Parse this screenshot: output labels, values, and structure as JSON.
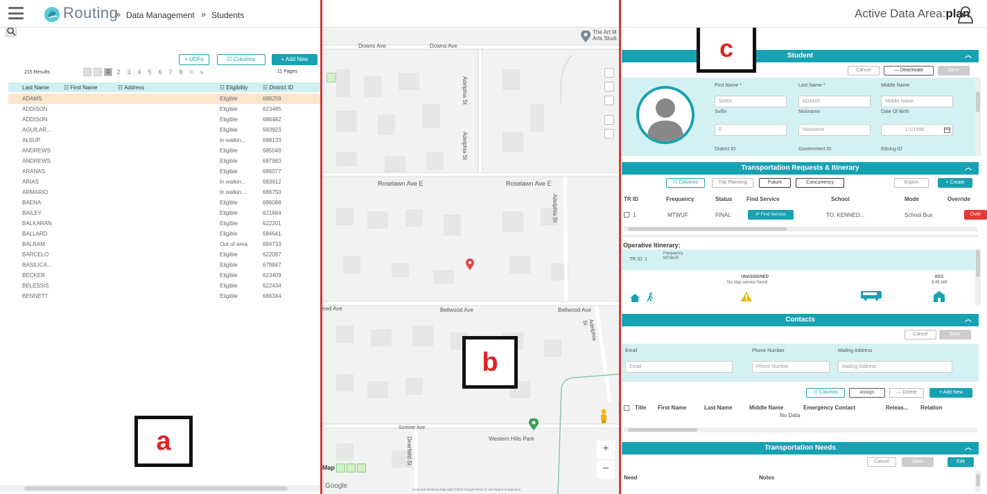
{
  "header": {
    "app_name": "Routing",
    "breadcrumb": [
      "Data Management",
      "Students"
    ],
    "breadcrumb_sep": "»",
    "active_area_label": "Active Data Area:",
    "active_area_value": "plan"
  },
  "panel_a": {
    "label": "a",
    "buttons": {
      "udfs": "+ UDFs",
      "columns": "☷ Columns",
      "add_new": "+ Add New"
    },
    "results": "215 Results",
    "pages": "11 Pages",
    "page_numbers": [
      "1",
      "2",
      "3",
      "4",
      "5",
      "6",
      "7",
      "8"
    ],
    "pager_next": ">",
    "pager_last": "»",
    "columns": [
      "Last Name",
      "☷ First Name",
      "☷ Address",
      "☷ Eligibility",
      "☷ District ID"
    ],
    "rows": [
      {
        "last": "ADAMS",
        "elig": "Eligible",
        "id": "688259"
      },
      {
        "last": "ADDISON",
        "elig": "Eligible",
        "id": "623485"
      },
      {
        "last": "ADDISON",
        "elig": "Eligible",
        "id": "686482"
      },
      {
        "last": "AGUILAR...",
        "elig": "Eligible",
        "id": "683923"
      },
      {
        "last": "ALSUP",
        "elig": "In walkin...",
        "id": "688133"
      },
      {
        "last": "ANDREWS",
        "elig": "Eligible",
        "id": "685049"
      },
      {
        "last": "ANDREWS",
        "elig": "Eligible",
        "id": "687983"
      },
      {
        "last": "ARANAS",
        "elig": "Eligible",
        "id": "686077"
      },
      {
        "last": "ARIAS",
        "elig": "In walkin...",
        "id": "683912"
      },
      {
        "last": "ARMARIO",
        "elig": "In walkin...",
        "id": "686750"
      },
      {
        "last": "BAENA",
        "elig": "Eligible",
        "id": "686088"
      },
      {
        "last": "BAILEY",
        "elig": "Eligible",
        "id": "621684"
      },
      {
        "last": "BALKARAN",
        "elig": "Eligible",
        "id": "622201"
      },
      {
        "last": "BALLARD",
        "elig": "Eligible",
        "id": "684641"
      },
      {
        "last": "BALRAM",
        "elig": "Out of area",
        "id": "684733"
      },
      {
        "last": "BARCELO",
        "elig": "Eligible",
        "id": "622097"
      },
      {
        "last": "BASILICA...",
        "elig": "Eligible",
        "id": "679847"
      },
      {
        "last": "BECKER",
        "elig": "Eligible",
        "id": "623409"
      },
      {
        "last": "BELESSIS",
        "elig": "Eligible",
        "id": "622434"
      },
      {
        "last": "BENNETT",
        "elig": "Eligible",
        "id": "686344"
      }
    ]
  },
  "panel_b": {
    "label": "b",
    "streets": {
      "downs1": "Downs Ave",
      "downs2": "Downs Ave",
      "adelphia1": "Adelphia St",
      "adelphia2": "Adelphia St",
      "roselawn1": "Roselawn Ave E",
      "roselawn2": "Roselawn Ave E",
      "adelphia3": "Adelphia St",
      "bellwood1": "eed Ave",
      "bellwood2": "Bellwood Ave",
      "bellwood3": "Bellwood Ave",
      "adelphia4": "Adelphia St",
      "sumner": "Sumner Ave",
      "western": "Western Hills Park",
      "dearfield": "Dearfield St"
    },
    "poi": "The Art M Arts Studi",
    "map_type": "Map",
    "zoom_in": "+",
    "zoom_out": "−",
    "google": "Google",
    "footer": "Keyboard shortcuts   Map data ©2022 Google   Terms of Use   Report a map error"
  },
  "panel_c": {
    "label": "c",
    "student": {
      "title": "Student",
      "buttons": {
        "cancel": "Cancel",
        "deactivate": "— Deactivate",
        "save": "Save"
      },
      "fields": {
        "first_name_label": "First Name *",
        "first_name": "SARA",
        "last_name_label": "Last Name *",
        "last_name": "ADAMS",
        "middle_name_label": "Middle Name",
        "middle_name_ph": "Middle Name",
        "suffix_label": "Suffix",
        "suffix": "E",
        "nickname_label": "Nickname",
        "nickname_ph": "Nickname",
        "dob_label": "Date Of Birth",
        "dob": "1/1/1995",
        "district_label": "District ID",
        "government_label": "Government ID",
        "edulog_label": "Edulog ID"
      }
    },
    "transport": {
      "title": "Transportation Requests & Itinerary",
      "buttons": {
        "columns": "☷ Columns",
        "trip": "Trip Planning",
        "future": "Future",
        "concurrency": "Concurrency",
        "export": "Export",
        "create": "+ Create"
      },
      "columns": [
        "TR ID",
        "Frequency",
        "Status",
        "Find Service",
        "School",
        "Mode",
        "Override"
      ],
      "row": {
        "id": "1",
        "freq": "MTWUF",
        "status": "FINAL",
        "find": "⇄ Find Service",
        "school": "TO: KENNED...",
        "mode": "School Bus",
        "override": "Over"
      },
      "operative_label": "Operative Itinerary:",
      "op_trid": "TR ID: 1",
      "op_freq_label": "Frequency",
      "op_freq": "MTWUF",
      "unassigned": "UNASSIGNED",
      "no_stop": "No stop service found",
      "kes": "KES",
      "kes_time": "8:45 AM"
    },
    "contacts": {
      "title": "Contacts",
      "buttons": {
        "cancel": "Cancel",
        "save": "Save",
        "columns": "☷ Columns",
        "assign": "Assign",
        "delete": "— Delete",
        "add_new": "+ Add New"
      },
      "email_label": "Email",
      "email_ph": "Email",
      "phone_label": "Phone Number",
      "phone_ph": "Phone Number",
      "mail_label": "Mailing Address",
      "mail_ph": "Mailing Address",
      "columns": [
        "Title",
        "First Name",
        "Last Name",
        "Middle Name",
        "Emergency Contact",
        "Releas...",
        "Relation"
      ],
      "no_data": "No Data"
    },
    "needs": {
      "title": "Transportation Needs",
      "buttons": {
        "cancel": "Cancel",
        "save": "Save",
        "edit": "Edit"
      },
      "columns": [
        "Need",
        "Notes"
      ]
    }
  },
  "colors": {
    "teal": "#17a2b2",
    "light_teal": "#d3f1f3",
    "red_divider": "#d93535",
    "selected_row": "#fbe5cb"
  }
}
